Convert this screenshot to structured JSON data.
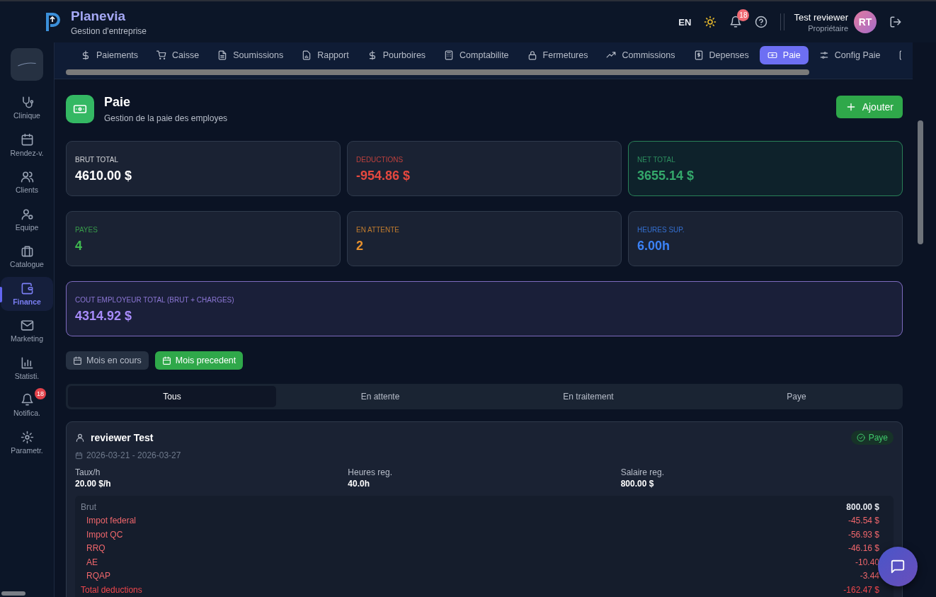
{
  "header": {
    "app_name": "Planevia",
    "subtitle": "Gestion d'entreprise",
    "language": "EN",
    "notifications": "18",
    "user": {
      "name": "Test reviewer",
      "role": "Propriétaire",
      "initials": "RT"
    }
  },
  "sidebar": {
    "items": [
      {
        "label": "Clinique",
        "selected": false
      },
      {
        "label": "Rendez-v.",
        "selected": false
      },
      {
        "label": "Clients",
        "selected": false
      },
      {
        "label": "Equipe",
        "selected": false
      },
      {
        "label": "Catalogue",
        "selected": false
      },
      {
        "label": "Finance",
        "selected": true
      },
      {
        "label": "Marketing",
        "selected": false
      },
      {
        "label": "Statisti.",
        "selected": false
      },
      {
        "label": "Notifica.",
        "selected": false,
        "badge": "18"
      },
      {
        "label": "Parametr.",
        "selected": false
      }
    ]
  },
  "tabs": [
    {
      "label": "Paiements",
      "selected": false
    },
    {
      "label": "Caisse",
      "selected": false
    },
    {
      "label": "Soumissions",
      "selected": false
    },
    {
      "label": "Rapport",
      "selected": false
    },
    {
      "label": "Pourboires",
      "selected": false
    },
    {
      "label": "Comptabilite",
      "selected": false
    },
    {
      "label": "Fermetures",
      "selected": false
    },
    {
      "label": "Commissions",
      "selected": false
    },
    {
      "label": "Depenses",
      "selected": false
    },
    {
      "label": "Paie",
      "selected": true
    },
    {
      "label": "Config Paie",
      "selected": false
    }
  ],
  "page": {
    "title": "Paie",
    "subtitle": "Gestion de la paie des employes",
    "add_button": "Ajouter"
  },
  "stats": [
    {
      "label": "BRUT TOTAL",
      "value": "4610.00 $",
      "color": "#ffffff",
      "tinted": false
    },
    {
      "label": "DEDUCTIONS",
      "value": "-954.86 $",
      "color": "#e5483f",
      "tinted": false
    },
    {
      "label": "NET TOTAL",
      "value": "3655.14 $",
      "color": "#34a86b",
      "tinted": true
    },
    {
      "label": "PAYES",
      "value": "4",
      "color": "#3fb950",
      "tinted": false
    },
    {
      "label": "EN ATTENTE",
      "value": "2",
      "color": "#e8912d",
      "tinted": false
    },
    {
      "label": "HEURES SUP.",
      "value": "6.00h",
      "color": "#3b82f6",
      "tinted": false
    },
    {
      "label": "COUT EMPLOYEUR TOTAL (BRUT + CHARGES)",
      "value": "4314.92 $",
      "color": "#a78bfa",
      "tinted": true
    }
  ],
  "periods": [
    {
      "label": "Mois en cours",
      "selected": false
    },
    {
      "label": "Mois precedent",
      "selected": true
    }
  ],
  "filters": [
    {
      "label": "Tous",
      "selected": true
    },
    {
      "label": "En attente",
      "selected": false
    },
    {
      "label": "En traitement",
      "selected": false
    },
    {
      "label": "Paye",
      "selected": false
    }
  ],
  "payslip": {
    "name": "reviewer Test",
    "status": "Paye",
    "dates": "2026-03-21 - 2026-03-27",
    "fields": [
      {
        "label": "Taux/h",
        "value": "20.00 $/h"
      },
      {
        "label": "Heures reg.",
        "value": "40.0h"
      },
      {
        "label": "Salaire reg.",
        "value": "800.00 $"
      }
    ],
    "lines": [
      {
        "kind": "gross",
        "label": "Brut",
        "amount": "800.00 $"
      },
      {
        "kind": "deduction",
        "label": "Impot federal",
        "amount": "-45.54 $"
      },
      {
        "kind": "deduction",
        "label": "Impot QC",
        "amount": "-56.93 $"
      },
      {
        "kind": "deduction",
        "label": "RRQ",
        "amount": "-46.16 $"
      },
      {
        "kind": "deduction",
        "label": "AE",
        "amount": "-10.40"
      },
      {
        "kind": "deduction",
        "label": "RQAP",
        "amount": "-3.44"
      },
      {
        "kind": "total",
        "label": "Total deductions",
        "amount": "-162.47 $"
      }
    ]
  }
}
